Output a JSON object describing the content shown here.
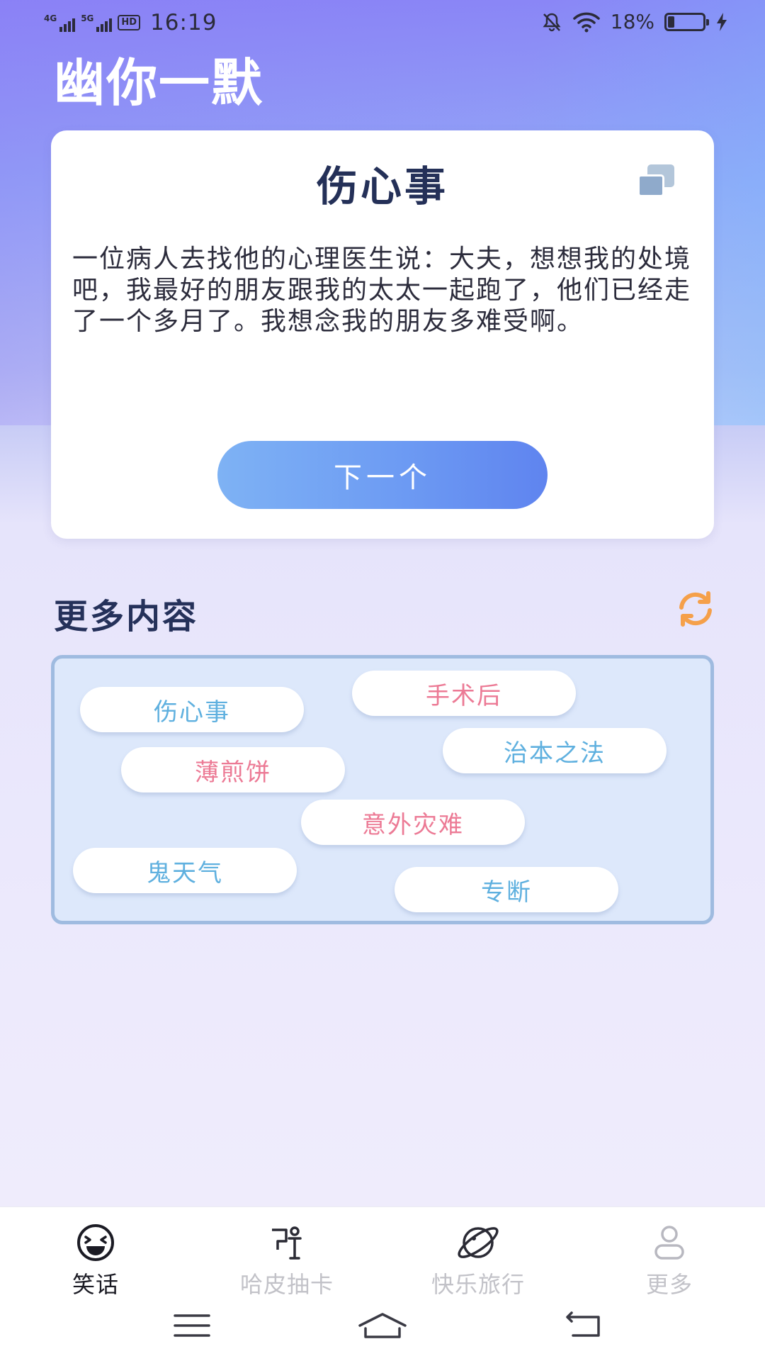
{
  "status_bar": {
    "signal1_tag": "4G",
    "signal2_tag": "5G",
    "hd_tag": "HD",
    "time": "16:19",
    "battery_percent": "18%",
    "battery_level": 0.18,
    "icons": [
      "signal-icon",
      "mute-icon",
      "wifi-icon",
      "battery-icon",
      "charging-icon"
    ]
  },
  "app": {
    "title": "幽你一默"
  },
  "joke_card": {
    "title": "伤心事",
    "body": "一位病人去找他的心理医生说：大夫，想想我的处境吧，我最好的朋友跟我的太太一起跑了，他们已经走了一个多月了。我想念我的朋友多难受啊。",
    "next_label": "下一个",
    "copy_icon": "copy-icon"
  },
  "more": {
    "title": "更多内容",
    "refresh_icon": "refresh-icon",
    "refresh_color": "#f5a04a",
    "tags": [
      {
        "label": "伤心事",
        "color": "blue"
      },
      {
        "label": "手术后",
        "color": "pink"
      },
      {
        "label": "治本之法",
        "color": "blue"
      },
      {
        "label": "薄煎饼",
        "color": "pink"
      },
      {
        "label": "意外灾难",
        "color": "pink"
      },
      {
        "label": "鬼天气",
        "color": "blue"
      },
      {
        "label": "专断",
        "color": "blue"
      }
    ]
  },
  "bottom_nav": {
    "items": [
      {
        "label": "笑话",
        "icon": "laugh-face-icon",
        "active": true
      },
      {
        "label": "哈皮抽卡",
        "icon": "card-draw-icon",
        "active": false
      },
      {
        "label": "快乐旅行",
        "icon": "planet-icon",
        "active": false
      },
      {
        "label": "更多",
        "icon": "user-icon",
        "active": false
      }
    ]
  },
  "system_nav": {
    "icons": [
      "menu-icon",
      "home-icon",
      "back-icon"
    ]
  },
  "colors": {
    "accent_blue": "#6d9bf3",
    "title_navy": "#243058",
    "tag_blue": "#5fb0df",
    "tag_pink": "#ec7a95"
  }
}
